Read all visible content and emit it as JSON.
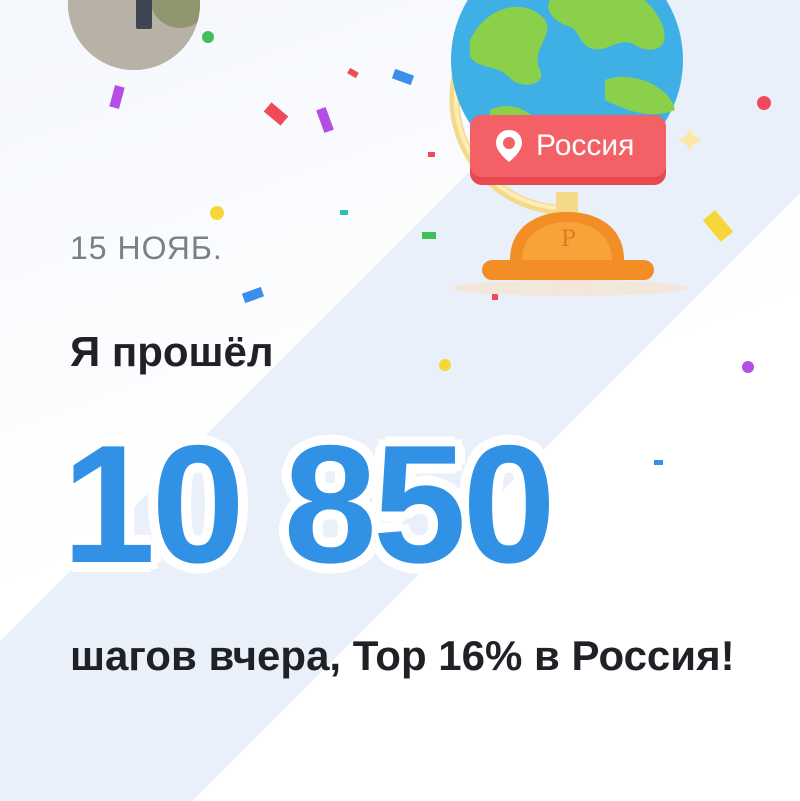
{
  "date": "15 НОЯБ.",
  "headline": "Я прошёл",
  "steps": "10 850",
  "subline": "шагов вчера, Top 16% в Россия!",
  "globe": {
    "country_label": "Россия",
    "stand_letter": "P"
  },
  "colors": {
    "accent": "#3191e5",
    "badge": "#f0575d",
    "ocean": "#3fb0e6",
    "land": "#8bd04a",
    "stand": "#f7a33a"
  }
}
